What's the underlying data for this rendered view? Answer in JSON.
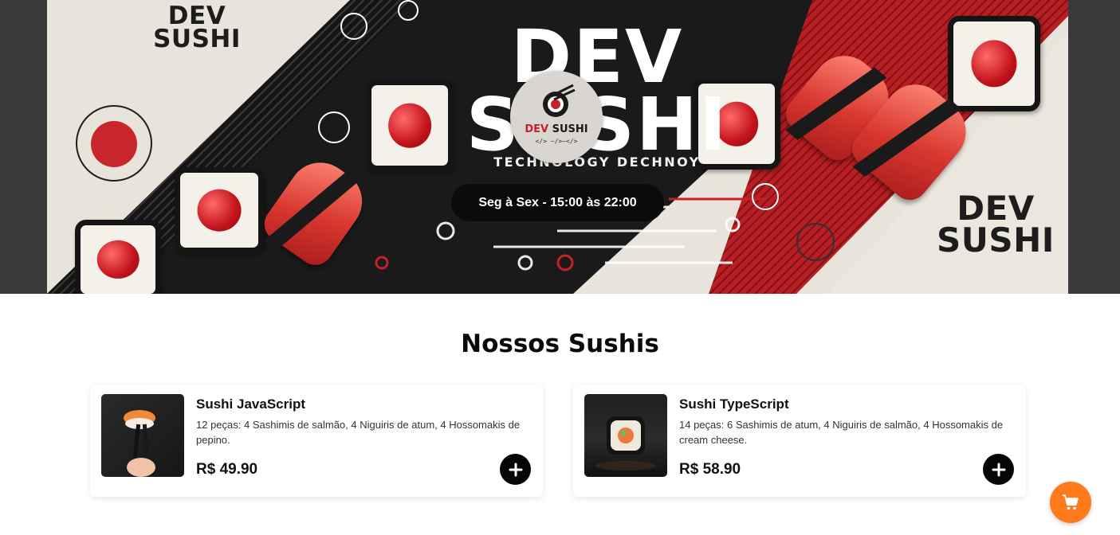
{
  "hero": {
    "brand_top_left": "DEV SUSHI",
    "brand_center": "DEV SUSHI",
    "brand_center_subtitle": "TECHNOLOGY DECHNOY",
    "brand_bottom_right": "DEV SUSHI",
    "logo": {
      "word1": "DEV",
      "word2": "SUSHI",
      "tagline": "</> ~/>~</>"
    },
    "hours": "Seg à Sex - 15:00 às 22:00"
  },
  "menu": {
    "title": "Nossos Sushis",
    "items": [
      {
        "name": "Sushi JavaScript",
        "description": "12 peças: 4 Sashimis de salmão, 4 Niguiris de atum, 4 Hossomakis de pepino.",
        "price": "R$ 49.90",
        "image_icon": "sushi-chopsticks-photo"
      },
      {
        "name": "Sushi TypeScript",
        "description": "14 peças: 6 Sashimis de atum, 4 Niguiris de salmão, 4 Hossomakis de cream cheese.",
        "price": "R$ 58.90",
        "image_icon": "sushi-roll-photo"
      }
    ]
  },
  "cart": {
    "icon": "cart-icon"
  },
  "colors": {
    "accent": "#ff7a1a",
    "button_dark": "#050505",
    "hero_red": "#c8202a"
  }
}
